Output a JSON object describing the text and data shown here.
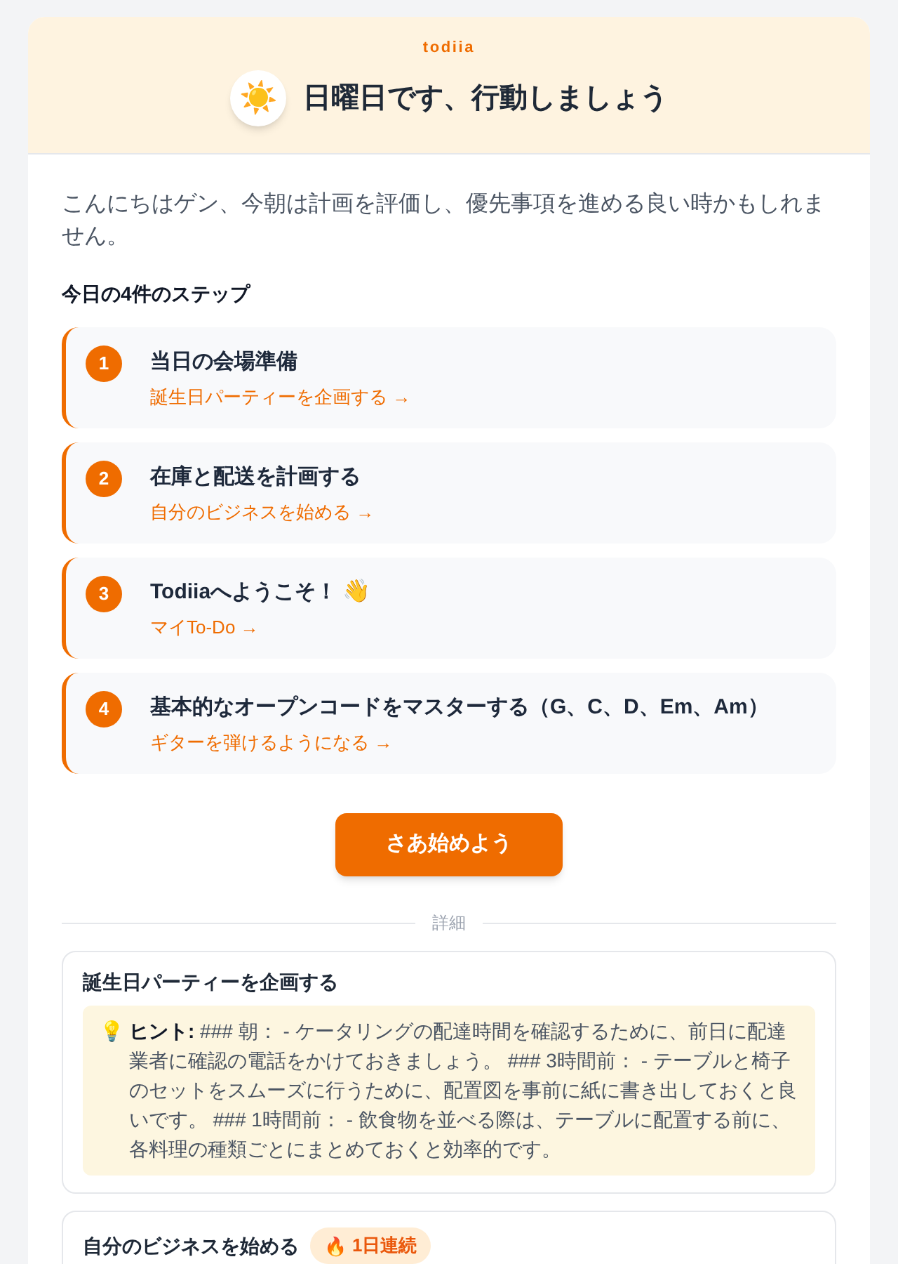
{
  "header": {
    "brand": "todiia",
    "icon": "☀️",
    "title": "日曜日です、行動しましょう"
  },
  "intro": "こんにちはゲン、今朝は計画を評価し、優先事項を進める良い時かもしれません。",
  "steps_heading": "今日の4件のステップ",
  "steps": [
    {
      "number": "1",
      "title": "当日の会場準備",
      "link": "誕生日パーティーを企画する →"
    },
    {
      "number": "2",
      "title": "在庫と配送を計画する",
      "link": "自分のビジネスを始める →"
    },
    {
      "number": "3",
      "title": "Todiiaへようこそ！",
      "emoji": "👋",
      "link": "マイTo-Do →"
    },
    {
      "number": "4",
      "title": "基本的なオープンコードをマスターする（G、C、D、Em、Am）",
      "link": "ギターを弾けるようになる →"
    }
  ],
  "start_button": "さあ始めよう",
  "divider_label": "詳細",
  "details": [
    {
      "title": "誕生日パーティーを企画する",
      "hint": {
        "icon": "💡",
        "text": "**ヒント:** ### 朝： - ケータリングの配達時間を確認するために、前日に配達業者に確認の電話をかけておきましょう。 ### 3時間前： - テーブルと椅子のセットをスムーズに行うために、配置図を事前に紙に書き出しておくと良いです。 ### 1時間前： - 飲食物を並べる際は、テーブルに配置する前に、各料理の種類ごとにまとめておくと効率的です。"
      }
    },
    {
      "title": "自分のビジネスを始める",
      "badge": {
        "icon": "🔥",
        "label": "1日連続"
      }
    }
  ]
}
